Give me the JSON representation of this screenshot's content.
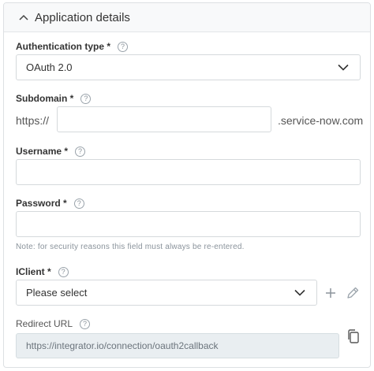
{
  "section": {
    "title": "Application details"
  },
  "auth_type": {
    "label": "Authentication type *",
    "value": "OAuth 2.0"
  },
  "subdomain": {
    "label": "Subdomain *",
    "prefix": "https://",
    "value": "",
    "suffix": ".service-now.com"
  },
  "username": {
    "label": "Username *",
    "value": ""
  },
  "password": {
    "label": "Password *",
    "value": "",
    "note": "Note: for security reasons this field must always be re-entered."
  },
  "iclient": {
    "label": "IClient *",
    "value": "Please select"
  },
  "redirect_url": {
    "label": "Redirect URL",
    "value": "https://integrator.io/connection/oauth2callback"
  },
  "help_glyph": "?",
  "colors": {
    "border": "#d5d9dc",
    "header_bg": "#f8f9fa",
    "readonly_bg": "#e9eef1",
    "icon": "#8a939b"
  },
  "icons": [
    "chevron-up-icon",
    "help-icon",
    "chevron-down-icon",
    "plus-icon",
    "pencil-icon",
    "copy-icon"
  ]
}
